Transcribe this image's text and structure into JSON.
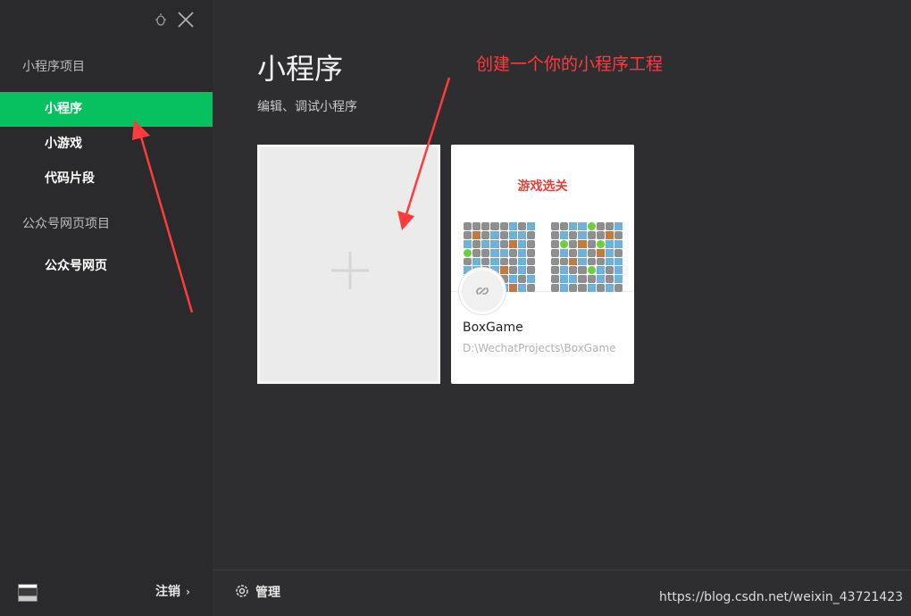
{
  "window": {
    "bug_icon": "bug-icon",
    "close_icon": "close-icon"
  },
  "sidebar": {
    "sections": [
      {
        "label": "小程序项目",
        "items": [
          "小程序",
          "小游戏",
          "代码片段"
        ]
      },
      {
        "label": "公众号网页项目",
        "items": [
          "公众号网页"
        ]
      }
    ],
    "active_item": "小程序",
    "logout_label": "注销"
  },
  "main": {
    "title": "小程序",
    "subtitle": "编辑、调试小程序",
    "new_project_icon": "plus-icon",
    "projects": [
      {
        "thumbnail_title": "游戏选关",
        "name": "BoxGame",
        "path": "D:\\WechatProjects\\BoxGame"
      }
    ]
  },
  "bottom": {
    "manage_label": "管理"
  },
  "annotation": {
    "text": "创建一个你的小程序工程"
  },
  "watermark": "https://blog.csdn.net/weixin_43721423",
  "colors": {
    "accent": "#07c160",
    "annotation": "#ff3b3b",
    "background": "#2e2e30",
    "sidebar": "#2a2a2c"
  }
}
